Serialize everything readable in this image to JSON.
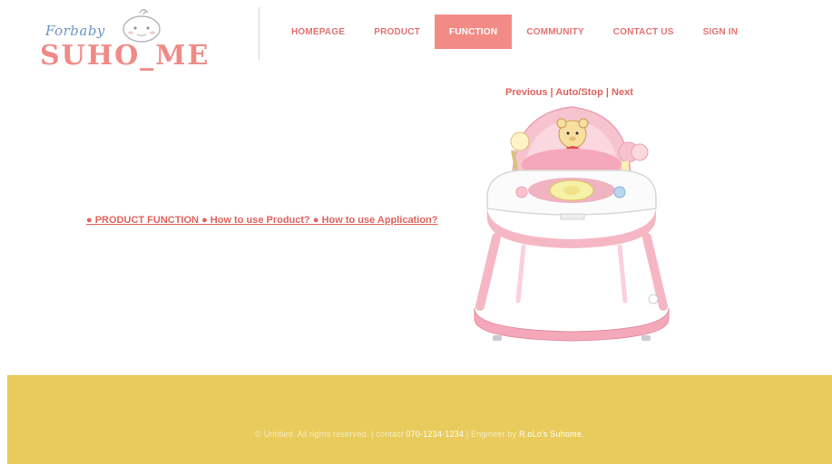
{
  "logo": {
    "small_text": "Forbaby",
    "big_text": "SUHO_ME"
  },
  "nav": {
    "items": [
      {
        "label": "HOMEPAGE"
      },
      {
        "label": "PRODUCT"
      },
      {
        "label": "FUNCTION",
        "active": true
      },
      {
        "label": "COMMUNITY"
      },
      {
        "label": "CONTACT US"
      },
      {
        "label": "SIGN IN"
      }
    ]
  },
  "function_links": {
    "dot": "●",
    "product_function": "PRODUCT FUNCTION",
    "how_to_use_product": "How to use Product?",
    "how_to_use_application": "How to use Application?"
  },
  "slider": {
    "previous": "Previous",
    "auto_stop": "Auto/Stop",
    "next": "Next",
    "separator": "|"
  },
  "footer": {
    "copyright": "© Untitled. All rights reserved.",
    "separator": "|",
    "contact_label": "contact",
    "contact_number": "070-1234-1234",
    "engineer_label": "Engineer by",
    "engineer_name": "R.oLo's Suhome."
  },
  "colors": {
    "accent": "#f28b86",
    "link": "#e0635f",
    "footer_bg": "#e8cb5c"
  }
}
